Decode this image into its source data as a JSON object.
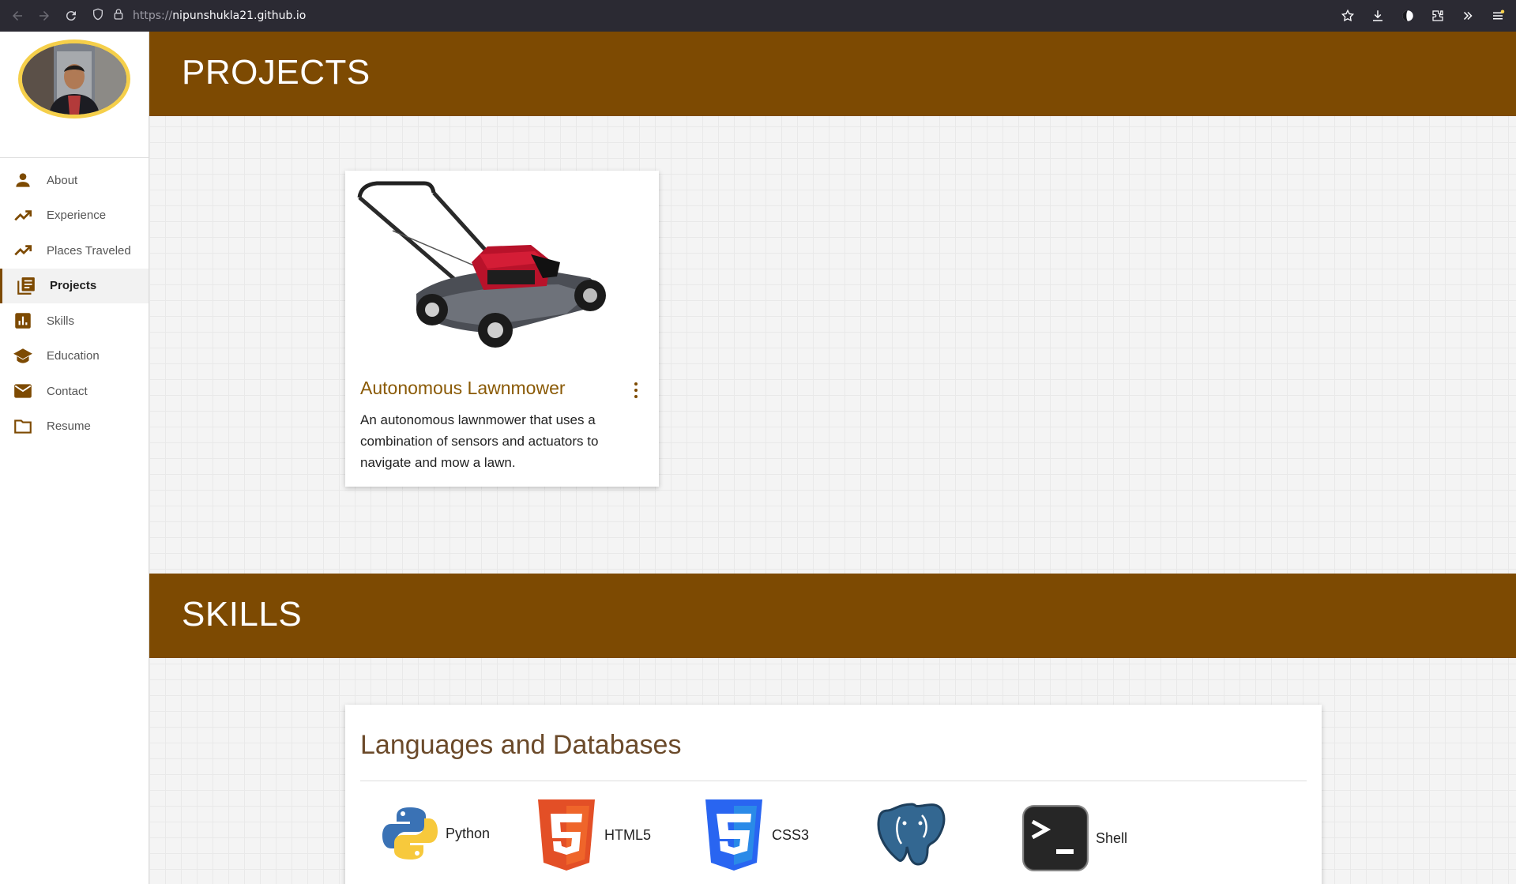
{
  "browser": {
    "url_scheme": "https://",
    "url_host": "nipunshukla21.github.io",
    "icons": [
      "back-icon",
      "forward-icon",
      "reload-icon",
      "shield-icon",
      "lock-icon",
      "star-icon",
      "download-icon",
      "profile-icon",
      "extensions-icon",
      "overflow-icon",
      "menu-icon"
    ]
  },
  "sidebar": {
    "items": [
      {
        "label": "About",
        "icon": "person-icon"
      },
      {
        "label": "Experience",
        "icon": "trending-icon"
      },
      {
        "label": "Places Traveled",
        "icon": "trending-icon"
      },
      {
        "label": "Projects",
        "icon": "library-icon",
        "active": true
      },
      {
        "label": "Skills",
        "icon": "bar-chart-icon"
      },
      {
        "label": "Education",
        "icon": "school-icon"
      },
      {
        "label": "Contact",
        "icon": "mail-icon"
      },
      {
        "label": "Resume",
        "icon": "folder-icon"
      }
    ]
  },
  "projects": {
    "heading": "PROJECTS",
    "card": {
      "title": "Autonomous Lawnmower",
      "description": "An autonomous lawnmower that uses a combination of sensors and actuators to navigate and mow a lawn."
    }
  },
  "skills": {
    "heading": "SKILLS",
    "card_title": "Languages and Databases",
    "items": [
      {
        "label": "Python",
        "icon": "python-icon"
      },
      {
        "label": "HTML5",
        "icon": "html5-icon"
      },
      {
        "label": "CSS3",
        "icon": "css3-icon"
      },
      {
        "label": "",
        "icon": "postgresql-icon"
      },
      {
        "label": "Shell",
        "icon": "terminal-icon"
      }
    ]
  },
  "colors": {
    "accent": "#7d4a02",
    "project_title": "#8a5a06",
    "avatar_ring": "#f5cf4a",
    "browser_bar": "#2b2a33"
  }
}
